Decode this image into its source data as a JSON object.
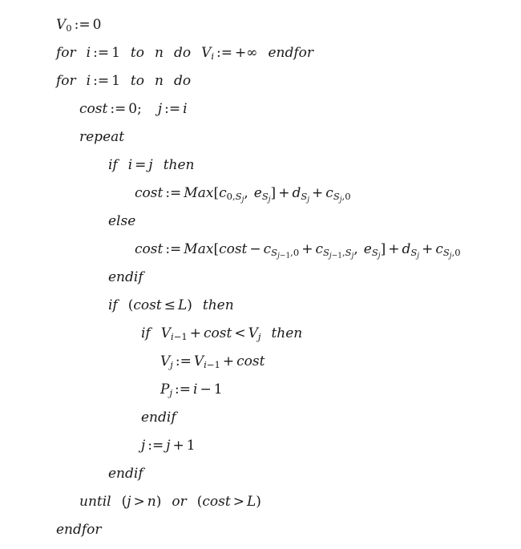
{
  "document": {
    "type": "algorithm-pseudocode",
    "background_color": "#ffffff",
    "text_color": "#1a1a1a",
    "lines": [
      {
        "id": "l1",
        "indent": 0,
        "text": "V_0 := 0"
      },
      {
        "id": "l2",
        "indent": 0,
        "text": "for i := 1 to n do V_i := +∞ endfor"
      },
      {
        "id": "l3",
        "indent": 0,
        "text": "for i := 1 to n do"
      },
      {
        "id": "l4",
        "indent": 1,
        "text": "cost := 0;  j := i"
      },
      {
        "id": "l5",
        "indent": 1,
        "text": "repeat"
      },
      {
        "id": "l6",
        "indent": 2,
        "text": "if i = j then"
      },
      {
        "id": "l7",
        "indent": 3,
        "text": "cost := Max[c_{0,S_j}, e_{S_j}] + d_{S_j} + c_{S_j,0}"
      },
      {
        "id": "l8",
        "indent": 2,
        "text": "else"
      },
      {
        "id": "l9",
        "indent": 3,
        "text": "cost := Max[cost − c_{S_{j−1},0} + c_{S_{j−1},S_j}, e_{S_j}] + d_{S_j} + c_{S_j,0}"
      },
      {
        "id": "l10",
        "indent": 2,
        "text": "endif"
      },
      {
        "id": "l11",
        "indent": 2,
        "text": "if (cost ≤ L) then"
      },
      {
        "id": "l12",
        "indent": 4,
        "text": "if V_{i−1} + cost < V_j then"
      },
      {
        "id": "l13",
        "indent": 5,
        "text": "V_j := V_{i−1} + cost"
      },
      {
        "id": "l14",
        "indent": 5,
        "text": "P_j := i − 1"
      },
      {
        "id": "l15",
        "indent": 4,
        "text": "endif"
      },
      {
        "id": "l16",
        "indent": 4,
        "text": "j := j + 1"
      },
      {
        "id": "l17",
        "indent": 2,
        "text": "endif"
      },
      {
        "id": "l18",
        "indent": 1,
        "text": "until (j > n) or (cost > L)"
      },
      {
        "id": "l19",
        "indent": 0,
        "text": "endfor"
      }
    ],
    "tokens": {
      "kw_for": "for",
      "kw_to": "to",
      "kw_do": "do",
      "kw_endfor": "endfor",
      "kw_repeat": "repeat",
      "kw_until": "until",
      "kw_if": "if",
      "kw_then": "then",
      "kw_else": "else",
      "kw_endif": "endif",
      "kw_or": "or",
      "fn_max": "Max",
      "var_V": "V",
      "var_P": "P",
      "var_c": "c",
      "var_d": "d",
      "var_e": "e",
      "var_S": "S",
      "var_L": "L",
      "var_n": "n",
      "var_i": "i",
      "var_j": "j",
      "var_cost": "cost",
      "assign": ":=",
      "eq": "=",
      "lt": "<",
      "gt": ">",
      "le": "≤",
      "plus": "+",
      "minus": "−",
      "infinity": "∞",
      "plus_infinity": "+∞",
      "zero": "0",
      "one": "1",
      "semicolon": ";",
      "comma": ",",
      "bracket_open": "[",
      "bracket_close": "]",
      "paren_open": "(",
      "paren_close": ")"
    }
  }
}
